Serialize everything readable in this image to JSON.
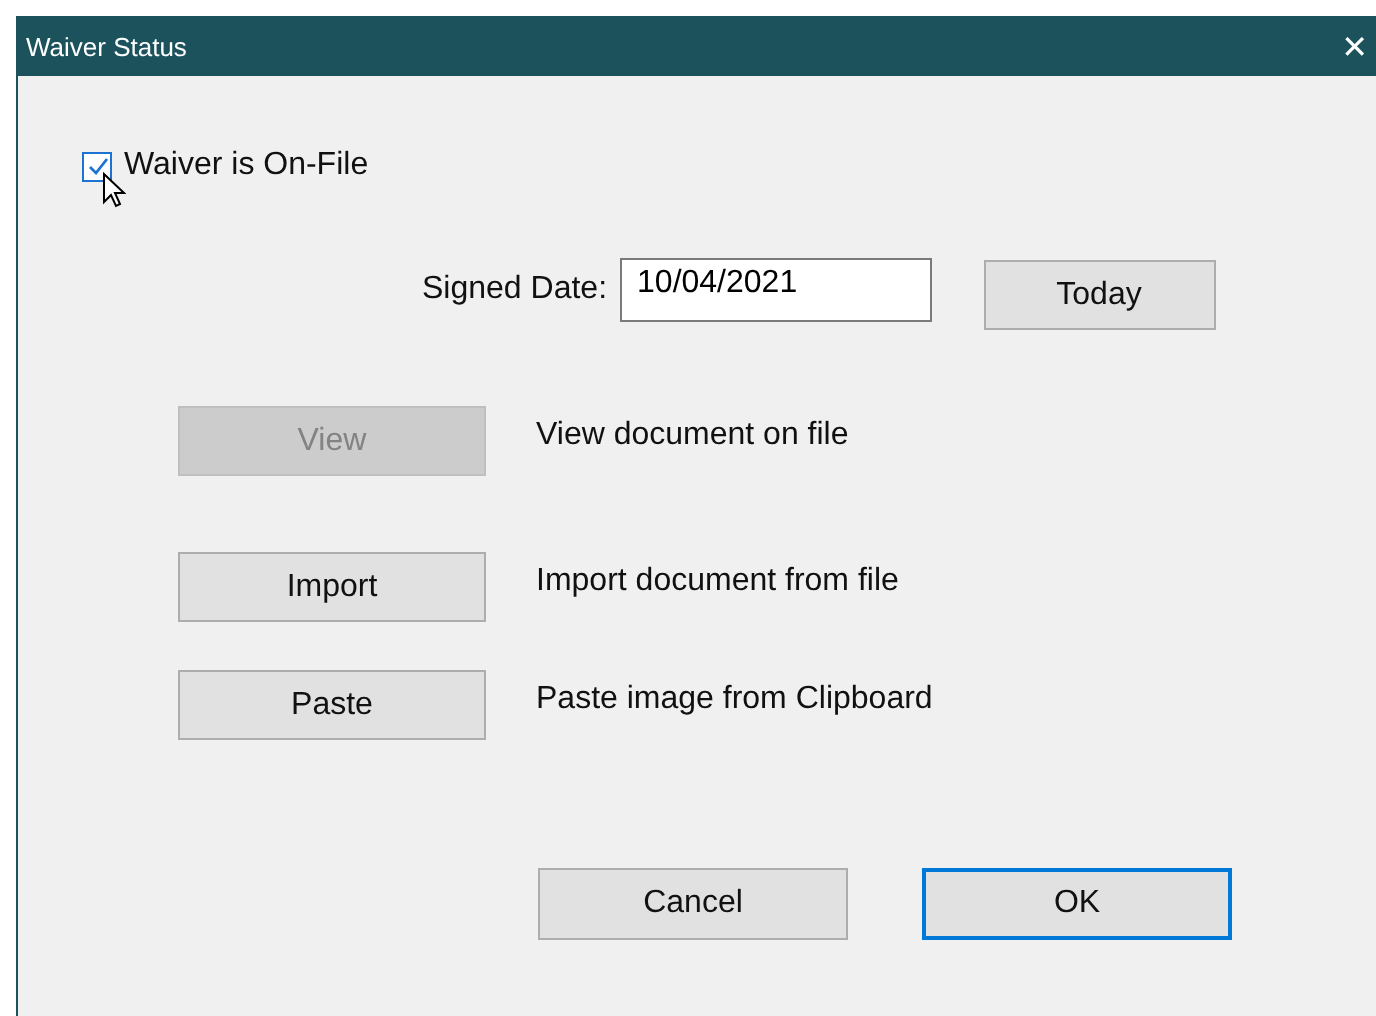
{
  "window": {
    "title": "Waiver Status",
    "close": "✕"
  },
  "waiver_checkbox": {
    "label": "Waiver is On-File",
    "checked": true
  },
  "signed_date": {
    "label": "Signed Date:",
    "value": "10/04/2021",
    "button": "Today"
  },
  "actions": [
    {
      "button": "View",
      "description": "View document on file",
      "disabled": true
    },
    {
      "button": "Import",
      "description": "Import document from file",
      "disabled": false
    },
    {
      "button": "Paste",
      "description": "Paste image from Clipboard",
      "disabled": false
    }
  ],
  "buttons": [
    {
      "label": "Cancel",
      "default": false
    },
    {
      "label": "OK",
      "default": true
    }
  ]
}
